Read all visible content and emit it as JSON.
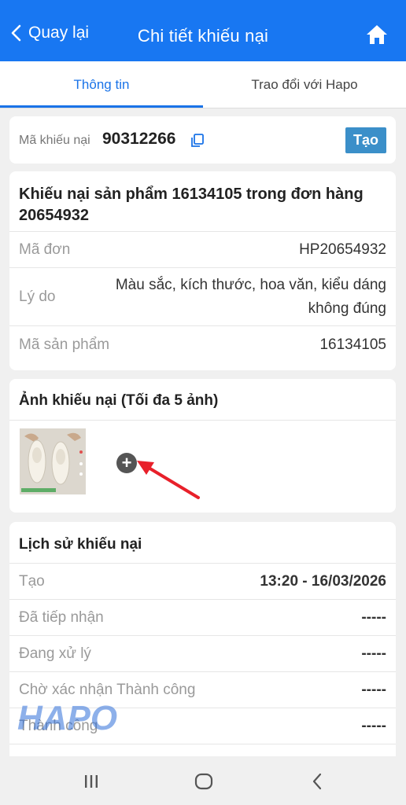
{
  "header": {
    "back_label": "Quay lại",
    "title": "Chi tiết khiếu nại"
  },
  "tabs": [
    {
      "label": "Thông tin"
    },
    {
      "label": "Trao đổi với Hapo"
    }
  ],
  "complaint": {
    "code_label": "Mã khiếu nại",
    "code": "90312266",
    "create_label": "Tạo"
  },
  "info": {
    "title": "Khiếu nại sản phẩm 16134105 trong đơn hàng 20654932",
    "order_label": "Mã đơn",
    "order_value": "HP20654932",
    "reason_label": "Lý do",
    "reason_line1": "Màu sắc, kích thước, hoa văn, kiểu dáng",
    "reason_line2": "không đúng",
    "product_label": "Mã sản phẩm",
    "product_value": "16134105"
  },
  "images": {
    "title": "Ảnh khiếu nại (Tối đa 5 ảnh)"
  },
  "history": {
    "title": "Lịch sử khiếu nại",
    "rows": [
      {
        "label": "Tạo",
        "value": "13:20 - 16/03/2026"
      },
      {
        "label": "Đã tiếp nhận",
        "value": "-----"
      },
      {
        "label": "Đang xử lý",
        "value": "-----"
      },
      {
        "label": "Chờ xác nhận Thành công",
        "value": "-----"
      },
      {
        "label": "Thành công",
        "value": "-----"
      }
    ]
  },
  "watermark": "HAPO",
  "colors": {
    "header": "#1877f2",
    "active_tab": "#1a73e8",
    "create_button": "#3b8fc9",
    "arrow": "#e8202a"
  },
  "icons": {
    "back": "chevron-left-icon",
    "home": "home-icon",
    "copy": "copy-icon",
    "add": "plus-icon"
  }
}
